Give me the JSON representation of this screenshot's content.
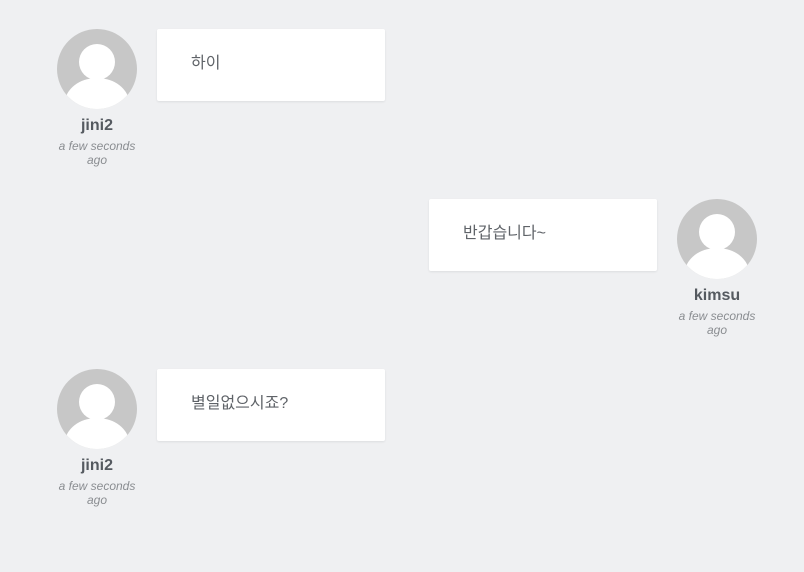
{
  "colors": {
    "background": "#eff0f2",
    "bubble": "#ffffff",
    "avatar": "#c7c7c7",
    "username": "#555a60",
    "timestamp": "#8a8d91"
  },
  "messages": [
    {
      "user": "jini2",
      "time": "a few seconds ago",
      "text": "하이",
      "side": "left",
      "avatar_icon": "user-avatar-icon"
    },
    {
      "user": "kimsu",
      "time": "a few seconds ago",
      "text": "반갑습니다~",
      "side": "right",
      "avatar_icon": "user-avatar-icon"
    },
    {
      "user": "jini2",
      "time": "a few seconds ago",
      "text": "별일없으시죠?",
      "side": "left",
      "avatar_icon": "user-avatar-icon"
    }
  ]
}
